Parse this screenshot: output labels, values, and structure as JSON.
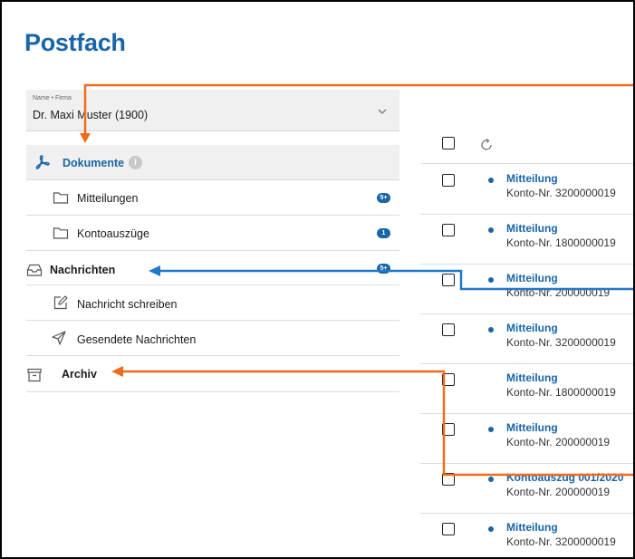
{
  "page": {
    "title": "Postfach"
  },
  "account": {
    "label": "Name • Firma",
    "name": "Dr. Maxi Muster (1900)",
    "chevron_icon": "chevron-down-icon"
  },
  "sidebar": {
    "documents": {
      "label": "Dokumente",
      "icon": "pdf-icon",
      "info": "i"
    },
    "mitteilungen": {
      "label": "Mitteilungen",
      "icon": "folder-icon",
      "badge": "5+"
    },
    "kontoauszuege": {
      "label": "Kontoauszüge",
      "icon": "folder-icon",
      "badge": "1"
    },
    "nachrichten": {
      "label": "Nachrichten",
      "icon": "inbox-icon",
      "badge": "5+"
    },
    "schreiben": {
      "label": "Nachricht schreiben",
      "icon": "compose-icon"
    },
    "gesendete": {
      "label": "Gesendete Nachrichten",
      "icon": "send-icon"
    },
    "archiv": {
      "label": "Archiv",
      "icon": "archive-icon"
    }
  },
  "messages": [
    {
      "subject": "Mitteilung",
      "account": "Konto-Nr. 3200000019",
      "unread": true
    },
    {
      "subject": "Mitteilung",
      "account": "Konto-Nr. 1800000019",
      "unread": true
    },
    {
      "subject": "Mitteilung",
      "account": "Konto-Nr. 200000019",
      "unread": true
    },
    {
      "subject": "Mitteilung",
      "account": "Konto-Nr. 3200000019",
      "unread": true
    },
    {
      "subject": "Mitteilung",
      "account": "Konto-Nr. 1800000019",
      "unread": false
    },
    {
      "subject": "Mitteilung",
      "account": "Konto-Nr. 200000019",
      "unread": true
    },
    {
      "subject": "Kontoauszug 001/2020",
      "account": "Konto-Nr. 200000019",
      "unread": true
    },
    {
      "subject": "Mitteilung",
      "account": "Konto-Nr. 3200000019",
      "unread": true
    }
  ],
  "colors": {
    "brand": "#1865a8",
    "annotation_orange": "#f26b1d",
    "annotation_blue": "#1f78c8"
  }
}
